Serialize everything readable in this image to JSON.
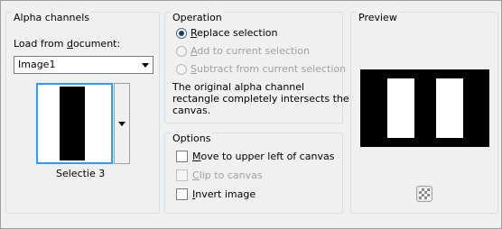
{
  "alpha_channels": {
    "title": "Alpha channels",
    "load_label_pre": "Load from ",
    "load_label_ul": "d",
    "load_label_post": "ocument:",
    "document_value": "Image1",
    "channel_name": "Selectie 3"
  },
  "operation": {
    "title": "Operation",
    "replace": {
      "ul": "R",
      "rest": "eplace selection",
      "checked": true,
      "enabled": true
    },
    "add": {
      "ul": "A",
      "rest": "dd to current selection",
      "checked": false,
      "enabled": false
    },
    "subtract": {
      "ul": "S",
      "rest": "ubtract from current selection",
      "checked": false,
      "enabled": false
    },
    "note_line1": "The original alpha channel",
    "note_line2": "rectangle completely intersects the",
    "note_line3": "canvas."
  },
  "options": {
    "title": "Options",
    "move": {
      "ul": "M",
      "rest": "ove to upper left of canvas",
      "checked": false,
      "enabled": true
    },
    "clip": {
      "ul": "C",
      "rest": "lip to canvas",
      "checked": false,
      "enabled": false
    },
    "invert": {
      "ul": "I",
      "rest": "nvert image",
      "checked": false,
      "enabled": true
    }
  },
  "preview": {
    "title": "Preview",
    "icon": "checkerboard-icon"
  }
}
